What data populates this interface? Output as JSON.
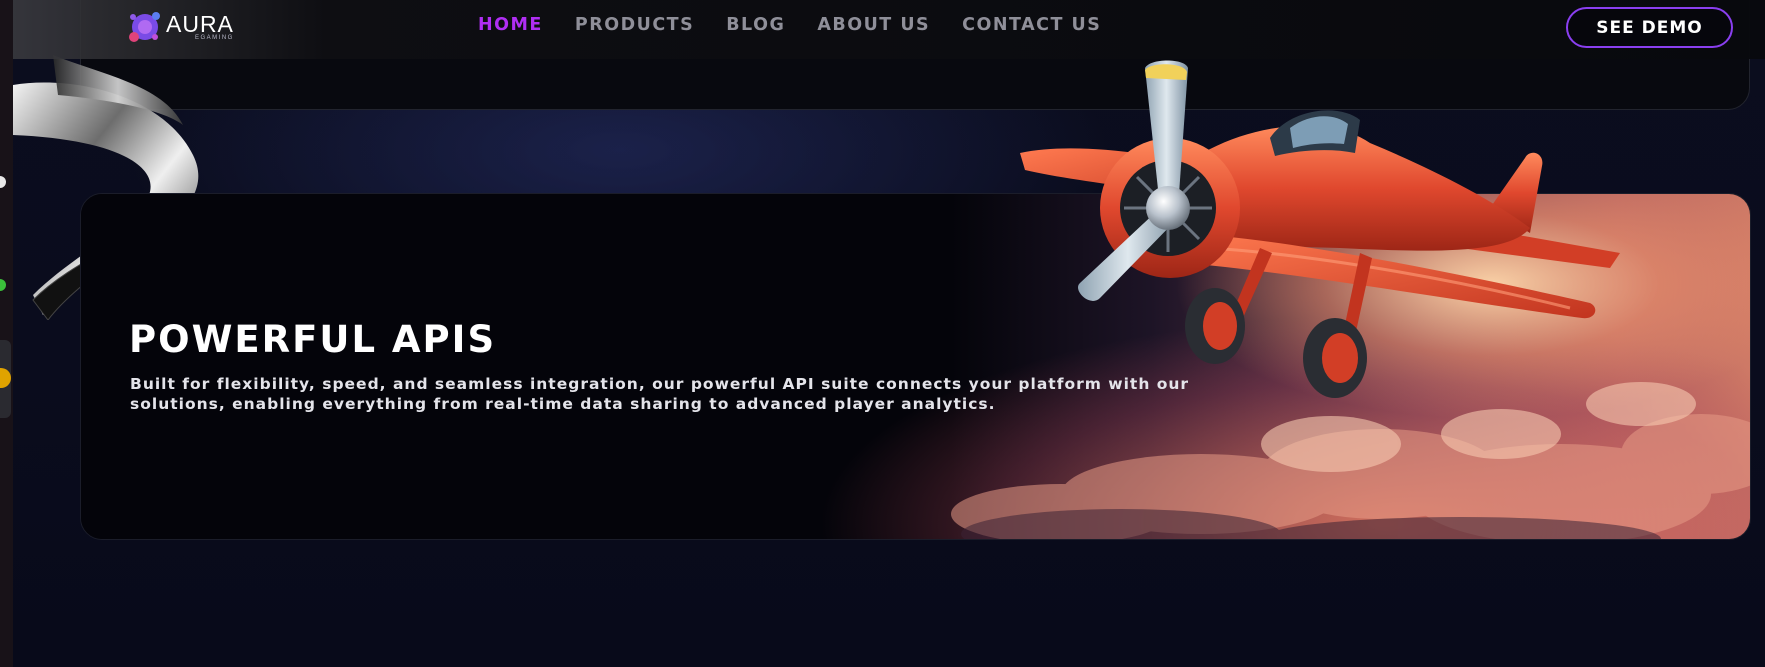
{
  "brand": {
    "name": "AURA",
    "sub": "EGAMING"
  },
  "nav": {
    "items": [
      {
        "label": "HOME",
        "active": true
      },
      {
        "label": "PRODUCTS",
        "active": false
      },
      {
        "label": "BLOG",
        "active": false
      },
      {
        "label": "ABOUT US",
        "active": false
      },
      {
        "label": "CONTACT US",
        "active": false
      }
    ],
    "cta_label": "SEE DEMO"
  },
  "hero": {
    "title": "POWERFUL APIS",
    "body": "Built for flexibility, speed, and seamless integration, our powerful API suite connects your platform with our solutions, enabling everything from real-time data sharing to advanced player analytics."
  },
  "icons": {
    "logo": "chip-logo-icon",
    "plane": "red-biplane-illustration",
    "ribbon": "silver-ribbon-decoration"
  },
  "colors": {
    "accent": "#b02ef4",
    "button_border": "#8a3ff0",
    "nav_inactive": "#8f8f99",
    "background": "#0a0c1c",
    "plane": "#e0482e"
  }
}
